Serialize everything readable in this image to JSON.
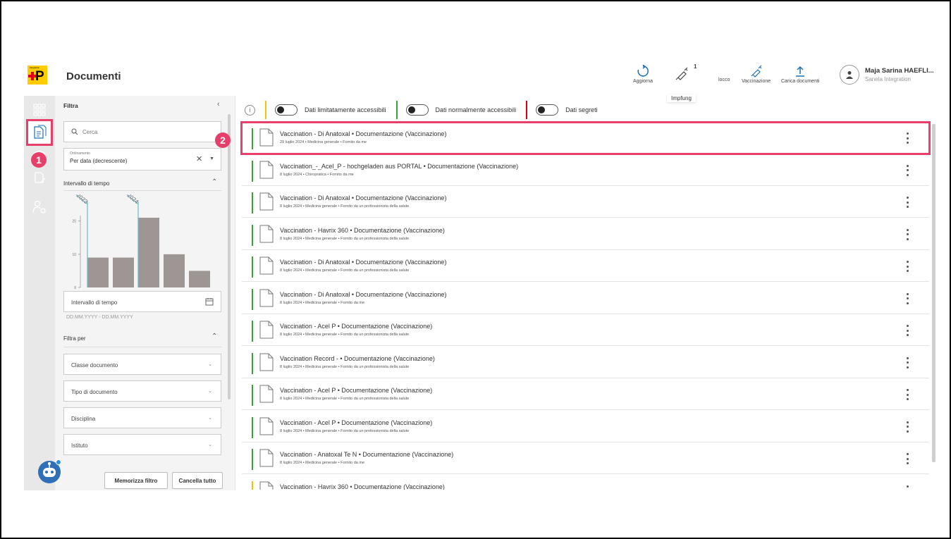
{
  "header": {
    "logo_letter": "P",
    "logo_micro": "Integration",
    "title": "Documenti",
    "actions": [
      {
        "label": "Aggiorna",
        "icon": "refresh-icon"
      },
      {
        "label": "",
        "icon": "syringe-icon",
        "badge": "1"
      },
      {
        "label": "locco",
        "icon": ""
      },
      {
        "label": "Vaccinazione",
        "icon": "syringe-icon"
      },
      {
        "label": "Carica documenti",
        "icon": "upload-icon"
      }
    ],
    "tooltip": "Impfung",
    "user": {
      "name": "Maja Sarina HAEFLI...",
      "org": "Sanela Integration"
    }
  },
  "filter": {
    "title": "Filtra",
    "search_placeholder": "Cerca",
    "sort_label": "Ordinamento",
    "sort_value": "Per data (decrescente)",
    "time_section": "Intervallo di tempo",
    "range_label": "Intervallo di tempo",
    "range_hint": "DD.MM.YYYY - DD.MM.YYYY",
    "filter_by": "Filtra per",
    "dropdowns": [
      "Classe documento",
      "Tipo di documento",
      "Disciplina",
      "Istituto"
    ],
    "save_btn": "Memorizza filtro",
    "clear_btn": "Cancella tutto"
  },
  "chart_data": {
    "type": "bar",
    "categories": [
      "",
      "",
      "",
      "",
      ""
    ],
    "values": [
      9,
      9,
      21,
      10,
      5
    ],
    "year_markers": [
      "2023",
      "2024"
    ],
    "yticks": [
      "0",
      "10",
      "20"
    ],
    "ylim": [
      0,
      28
    ]
  },
  "toolbar": {
    "toggles": [
      {
        "label": "Dati limitatamente accessibili",
        "color": "#f2c200"
      },
      {
        "label": "Dati normalmente accessibili",
        "color": "#3aa13a"
      },
      {
        "label": "Dati segreti",
        "color": "#d9001b"
      }
    ]
  },
  "annotations": {
    "one": "1",
    "two": "2"
  },
  "documents": [
    {
      "title": "Vaccination - Di Anatoxal • Documentazione (Vaccinazione)",
      "sub": "29 luglio 2024 • Medicina generale • Fornito da me"
    },
    {
      "title": "Vaccination_-_Acel_P - hochgeladen aus PORTAL • Documentazione (Vaccinazione)",
      "sub": "8 luglio 2024 • Chiropratica • Fornito da me"
    },
    {
      "title": "Vaccination - Di Anatoxal • Documentazione (Vaccinazione)",
      "sub": "8 luglio 2024 • Medicina generale • Fornito da un professionista della salute"
    },
    {
      "title": "Vaccination - Havrix 360 • Documentazione (Vaccinazione)",
      "sub": "8 luglio 2024 • Medicina generale • Fornito da un professionista della salute"
    },
    {
      "title": "Vaccination - Di Anatoxal • Documentazione (Vaccinazione)",
      "sub": "8 luglio 2024 • Medicina generale • Fornito da un professionista della salute"
    },
    {
      "title": "Vaccination - Di Anatoxal • Documentazione (Vaccinazione)",
      "sub": "8 luglio 2024 • Medicina generale • Fornito da me"
    },
    {
      "title": "Vaccination - Acel P • Documentazione (Vaccinazione)",
      "sub": "8 luglio 2024 • Medicina generale • Fornito da un professionista della salute"
    },
    {
      "title": "Vaccination Record - • Documentazione (Vaccinazione)",
      "sub": "8 luglio 2024 • Medicina generale • Fornito da un professionista della salute"
    },
    {
      "title": "Vaccination - Acel P • Documentazione (Vaccinazione)",
      "sub": "8 luglio 2024 • Medicina generale • Fornito da un professionista della salute"
    },
    {
      "title": "Vaccination - Acel P • Documentazione (Vaccinazione)",
      "sub": "8 luglio 2024 • Medicina generale • Fornito da un professionista della salute"
    },
    {
      "title": "Vaccination - Anatoxal Te N • Documentazione (Vaccinazione)",
      "sub": "8 luglio 2024 • Medicina generale • Fornito da me"
    },
    {
      "title": "Vaccination - Havrix 360 • Documentazione (Vaccinazione)",
      "sub": ""
    }
  ],
  "colors": {
    "accent_green": "#3aa13a",
    "accent_yellow": "#f2c200",
    "highlight": "#e6406a",
    "bar": "#9e9694",
    "year_line": "#6fb7c9"
  }
}
